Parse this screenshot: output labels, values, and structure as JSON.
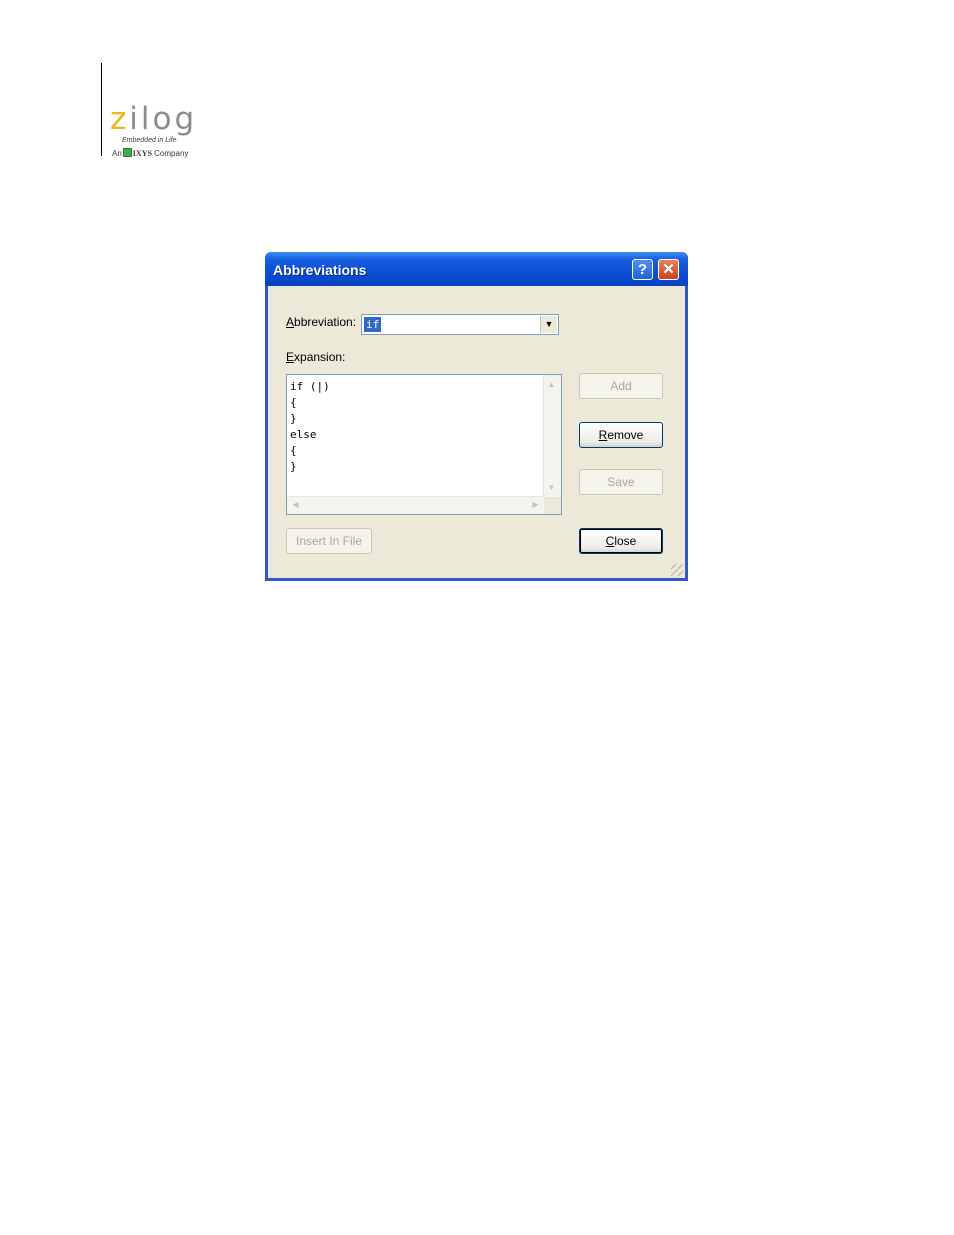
{
  "logo": {
    "wordmark_prefix": "z",
    "wordmark_rest": "ilog",
    "tagline": "Embedded in Life",
    "company_prefix": "An",
    "company_name": "IXYS",
    "company_suffix": "Company"
  },
  "window": {
    "title": "Abbreviations",
    "help_glyph": "?",
    "close_glyph": "✕"
  },
  "abbreviation": {
    "label_accel": "A",
    "label_rest": "bbreviation:",
    "value": "if"
  },
  "expansion": {
    "label_accel": "E",
    "label_rest": "xpansion:",
    "code": "if (|)\n{\n}\nelse\n{\n}"
  },
  "buttons": {
    "add": "Add",
    "remove_accel": "R",
    "remove_rest": "emove",
    "save": "Save",
    "insert_in_file": "Insert In File",
    "close_accel": "C",
    "close_rest": "lose"
  },
  "colors": {
    "titlebar": "#0a4fd4",
    "dialog_face": "#ece9d8",
    "selection": "#316ac5",
    "logo_accent": "#f2b519"
  }
}
